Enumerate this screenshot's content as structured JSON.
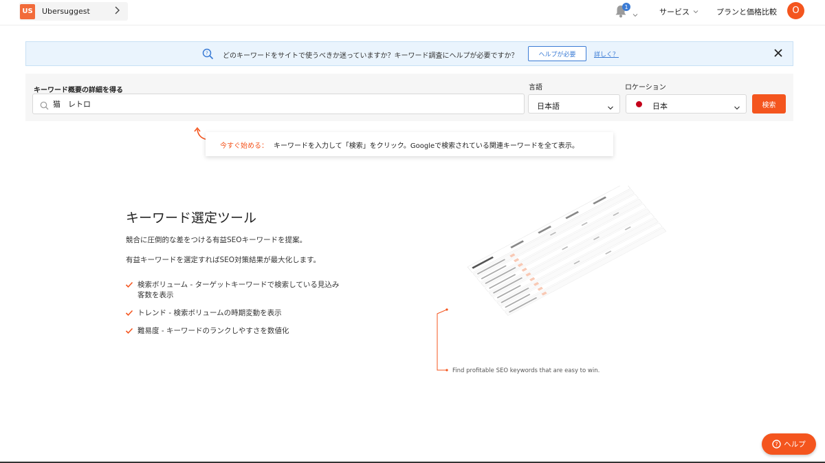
{
  "header": {
    "project_logo": "US",
    "project_name": "Ubersuggest",
    "notification_count": "1",
    "services_label": "サービス",
    "plans_label": "プランと価格比較",
    "avatar_initial": "O"
  },
  "banner": {
    "text": "どのキーワードをサイトで使うべきか迷っていますか？キーワード調査にヘルプが必要ですか？",
    "button_label": "ヘルプが必要",
    "link_label": "詳しく？"
  },
  "search": {
    "keyword_label": "キーワード概要の詳細を得る",
    "keyword_value": "猫　レトロ",
    "language_label": "言語",
    "language_value": "日本語",
    "location_label": "ロケーション",
    "location_value": "日本",
    "search_button": "検索"
  },
  "tip": {
    "highlight": "今すぐ始める：",
    "text": "キーワードを入力して「検索」をクリック。Googleで検索されている関連キーワードを全て表示。"
  },
  "feature": {
    "title": "キーワード選定ツール",
    "desc1": "競合に圧倒的な差をつける有益SEOキーワードを提案。",
    "desc2": "有益キーワードを選定すればSEO対策結果が最大化します。",
    "bullets": [
      "検索ボリューム - ターゲットキーワードで検索している見込み客数を表示",
      "トレンド - 検索ボリュームの時期変動を表示",
      "難易度 - キーワードのランクしやすさを数値化"
    ],
    "caption": "Find profitable SEO keywords that are easy to win."
  },
  "help": {
    "label": "ヘルプ"
  },
  "colors": {
    "accent": "#f4551e",
    "link": "#3a7bd5",
    "banner_bg": "#eaf4fd"
  },
  "icons": [
    "chevron-right-icon",
    "bell-icon",
    "chevron-down-icon",
    "search-help-icon",
    "close-icon",
    "search-icon",
    "curved-arrow-icon",
    "check-icon",
    "question-circle-icon"
  ]
}
